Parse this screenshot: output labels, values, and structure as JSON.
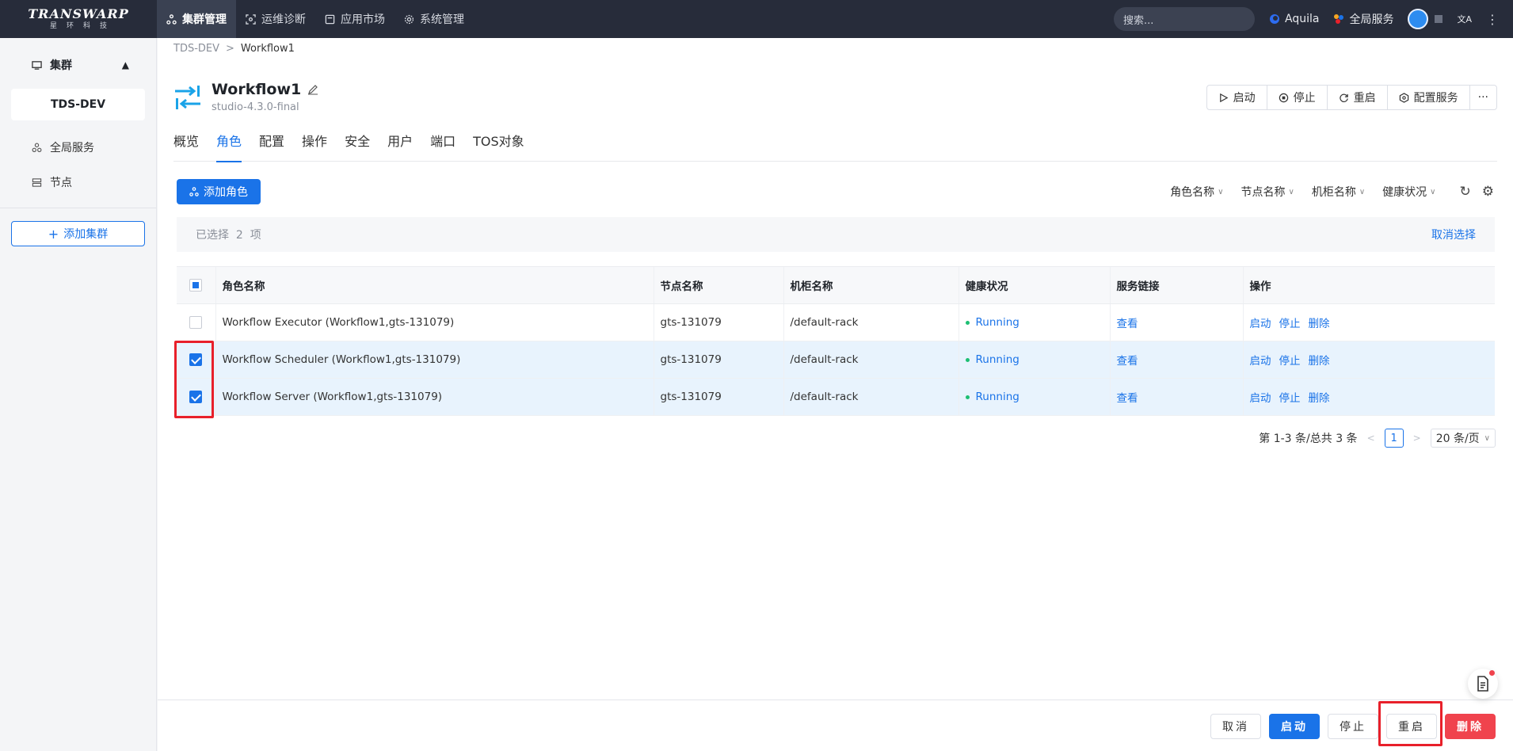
{
  "topbar": {
    "logo_brand": "TRANSWARP",
    "logo_sub": "星环科技",
    "nav": [
      {
        "label": "集群管理",
        "active": true
      },
      {
        "label": "运维诊断",
        "active": false
      },
      {
        "label": "应用市场",
        "active": false
      },
      {
        "label": "系统管理",
        "active": false
      }
    ],
    "search_placeholder": "搜索...",
    "aquila": "Aquila",
    "global_service": "全局服务",
    "lang_icon": "文A"
  },
  "sidebar": {
    "group_label": "集群",
    "cluster_name": "TDS-DEV",
    "items": [
      {
        "label": "全局服务"
      },
      {
        "label": "节点"
      }
    ],
    "add_cluster": "添加集群"
  },
  "breadcrumb": {
    "root": "TDS-DEV",
    "sep": ">",
    "current": "Workflow1"
  },
  "header": {
    "title": "Workflow1",
    "version": "studio-4.3.0-final",
    "actions": [
      "启动",
      "停止",
      "重启",
      "配置服务"
    ],
    "more": "···"
  },
  "tabs": [
    "概览",
    "角色",
    "配置",
    "操作",
    "安全",
    "用户",
    "端口",
    "TOS对象"
  ],
  "active_tab": "角色",
  "toolbar": {
    "add_role": "添加角色",
    "filters": [
      "角色名称",
      "节点名称",
      "机柜名称",
      "健康状况"
    ]
  },
  "selection": {
    "text": "已选择  2  项",
    "clear": "取消选择"
  },
  "table": {
    "columns": [
      "角色名称",
      "节点名称",
      "机柜名称",
      "健康状况",
      "服务链接",
      "操作"
    ],
    "rows": [
      {
        "checked": false,
        "role": "Workflow Executor (Workflow1,gts-131079)",
        "node": "gts-131079",
        "rack": "/default-rack",
        "health": "Running",
        "link": "查看",
        "ops": [
          "启动",
          "停止",
          "删除"
        ]
      },
      {
        "checked": true,
        "role": "Workflow Scheduler (Workflow1,gts-131079)",
        "node": "gts-131079",
        "rack": "/default-rack",
        "health": "Running",
        "link": "查看",
        "ops": [
          "启动",
          "停止",
          "删除"
        ]
      },
      {
        "checked": true,
        "role": "Workflow Server (Workflow1,gts-131079)",
        "node": "gts-131079",
        "rack": "/default-rack",
        "health": "Running",
        "link": "查看",
        "ops": [
          "启动",
          "停止",
          "删除"
        ]
      }
    ]
  },
  "pager": {
    "summary": "第 1-3 条/总共 3 条",
    "page": "1",
    "size": "20 条/页"
  },
  "footer": {
    "cancel": "取消",
    "start": "启动",
    "stop": "停止",
    "restart": "重启",
    "delete": "删除"
  },
  "colors": {
    "primary": "#1a73e8",
    "danger": "#f0434d",
    "topbar": "#272c3a",
    "running": "#1dbf73",
    "highlight": "#e8202a"
  }
}
